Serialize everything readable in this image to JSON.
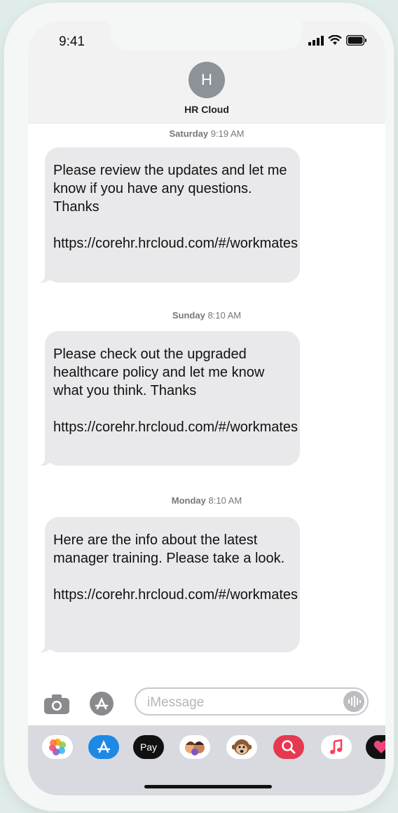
{
  "status": {
    "time": "9:41"
  },
  "contact": {
    "initial": "H",
    "name": "HR Cloud"
  },
  "messages": [
    {
      "day": "Saturday",
      "time": "9:19 AM",
      "text": "Please review the updates and let me know if you have any questions. Thanks",
      "link": "https://corehr.hrcloud.com/#/workmates"
    },
    {
      "day": "Sunday",
      "time": "8:10 AM",
      "text": "Please check out the upgraded healthcare policy and let me know what you think. Thanks",
      "link": "https://corehr.hrcloud.com/#/workmates"
    },
    {
      "day": "Monday",
      "time": "8:10 AM",
      "text": "Here are the info about the latest manager training. Please take a look.",
      "link": "https://corehr.hrcloud.com/#/workmates"
    }
  ],
  "compose": {
    "placeholder": "iMessage"
  },
  "app_tray": {
    "items": [
      {
        "name": "photos",
        "label": ""
      },
      {
        "name": "app-store",
        "label": ""
      },
      {
        "name": "apple-pay",
        "label": "Pay"
      },
      {
        "name": "memoji",
        "label": ""
      },
      {
        "name": "animoji",
        "label": ""
      },
      {
        "name": "search-images",
        "label": ""
      },
      {
        "name": "music",
        "label": ""
      },
      {
        "name": "digital-touch",
        "label": ""
      }
    ]
  }
}
